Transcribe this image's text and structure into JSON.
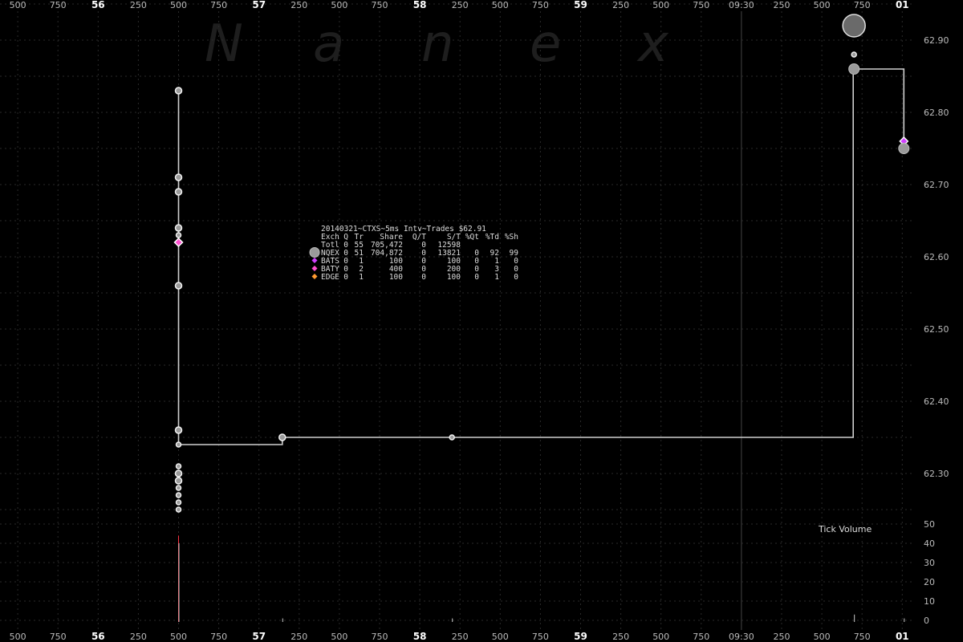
{
  "chart_data": {
    "type": "scatter",
    "title": "20140321~CTXS~5ms Intv~Trades $62.91",
    "watermark": [
      "N",
      "a",
      "n",
      "e",
      "x"
    ],
    "x_units": "ms",
    "x_range": [
      -1000,
      61000
    ],
    "x_ticks": [
      {
        "t": -1000,
        "label": "500",
        "major": false
      },
      {
        "t": -750,
        "label": "750",
        "major": false
      },
      {
        "t": -500,
        "label": "56",
        "major": true
      },
      {
        "t": -250,
        "label": "250",
        "major": false
      },
      {
        "t": 0,
        "label": "500",
        "major": false
      },
      {
        "t": 250,
        "label": "750",
        "major": false
      },
      {
        "t": 500,
        "label": "57",
        "major": true
      },
      {
        "t": 750,
        "label": "250",
        "major": false
      },
      {
        "t": 1000,
        "label": "500",
        "major": false
      },
      {
        "t": 1250,
        "label": "750",
        "major": false
      },
      {
        "t": 1500,
        "label": "58",
        "major": true
      },
      {
        "t": 1750,
        "label": "250",
        "major": false
      },
      {
        "t": 2000,
        "label": "500",
        "major": false
      },
      {
        "t": 2250,
        "label": "750",
        "major": false
      },
      {
        "t": 2500,
        "label": "59",
        "major": true
      },
      {
        "t": 2750,
        "label": "250",
        "major": false
      },
      {
        "t": 3000,
        "label": "500",
        "major": false
      },
      {
        "t": 3250,
        "label": "750",
        "major": false
      },
      {
        "t": 3500,
        "label": "09:30",
        "major": false
      },
      {
        "t": 3750,
        "label": "250",
        "major": false
      },
      {
        "t": 4000,
        "label": "500",
        "major": false
      },
      {
        "t": 4250,
        "label": "750",
        "major": false
      },
      {
        "t": 4500,
        "label": "01",
        "major": true
      }
    ],
    "price_axis": {
      "min": 62.24,
      "max": 62.94,
      "ticks": [
        "62.30",
        "62.40",
        "62.50",
        "62.60",
        "62.70",
        "62.80",
        "62.90"
      ]
    },
    "volume_axis": {
      "label": "Tick Volume",
      "min": 0,
      "max": 53,
      "ticks": [
        "0",
        "10",
        "20",
        "30",
        "40",
        "50"
      ]
    },
    "legend": {
      "header": [
        "Exch",
        "Q",
        "Tr",
        "Share",
        "Q/T",
        "S/T",
        "%Qt",
        "%Td",
        "%Sh"
      ],
      "rows": [
        {
          "exch": "Totl",
          "q": "0",
          "tr": "55",
          "share": "705,472",
          "qt": "0",
          "st": "12598",
          "pqt": "",
          "ptd": "",
          "psh": "",
          "marker": "none",
          "color": ""
        },
        {
          "exch": "NQEX",
          "q": "0",
          "tr": "51",
          "share": "704,872",
          "qt": "0",
          "st": "13821",
          "pqt": "0",
          "ptd": "92",
          "psh": "99",
          "marker": "circle",
          "color": "#9a9a9a"
        },
        {
          "exch": "BATS",
          "q": "0",
          "tr": "1",
          "share": "100",
          "qt": "0",
          "st": "100",
          "pqt": "0",
          "ptd": "1",
          "psh": "0",
          "marker": "diamond",
          "color": "#d040ff"
        },
        {
          "exch": "BATY",
          "q": "0",
          "tr": "2",
          "share": "400",
          "qt": "0",
          "st": "200",
          "pqt": "0",
          "ptd": "3",
          "psh": "0",
          "marker": "diamond",
          "color": "#ff4fd0"
        },
        {
          "exch": "EDGE",
          "q": "0",
          "tr": "1",
          "share": "100",
          "qt": "0",
          "st": "100",
          "pqt": "0",
          "ptd": "1",
          "psh": "0",
          "marker": "diamond",
          "color": "#ff9a30"
        }
      ]
    },
    "step_line": [
      {
        "t": 0,
        "p": 62.83
      },
      {
        "t": 0,
        "p": 62.34
      },
      {
        "t": 645,
        "p": 62.34
      },
      {
        "t": 645,
        "p": 62.35
      },
      {
        "t": 4195,
        "p": 62.35
      },
      {
        "t": 4195,
        "p": 62.86
      },
      {
        "t": 4510,
        "p": 62.86
      },
      {
        "t": 4510,
        "p": 62.75
      }
    ],
    "trades": [
      {
        "t": 0,
        "p": 62.83,
        "exch": "NQEX",
        "size": "s"
      },
      {
        "t": 0,
        "p": 62.71,
        "exch": "NQEX",
        "size": "s"
      },
      {
        "t": 0,
        "p": 62.69,
        "exch": "NQEX",
        "size": "s"
      },
      {
        "t": 0,
        "p": 62.64,
        "exch": "NQEX",
        "size": "s"
      },
      {
        "t": 0,
        "p": 62.63,
        "exch": "NQEX",
        "size": "xs"
      },
      {
        "t": 0,
        "p": 62.62,
        "exch": "BATY",
        "size": "s"
      },
      {
        "t": 0,
        "p": 62.56,
        "exch": "NQEX",
        "size": "s"
      },
      {
        "t": 0,
        "p": 62.36,
        "exch": "NQEX",
        "size": "s"
      },
      {
        "t": 0,
        "p": 62.34,
        "exch": "NQEX",
        "size": "xs"
      },
      {
        "t": 0,
        "p": 62.31,
        "exch": "NQEX",
        "size": "xs"
      },
      {
        "t": 0,
        "p": 62.3,
        "exch": "NQEX",
        "size": "s"
      },
      {
        "t": 0,
        "p": 62.29,
        "exch": "NQEX",
        "size": "s"
      },
      {
        "t": 0,
        "p": 62.28,
        "exch": "NQEX",
        "size": "xs"
      },
      {
        "t": 0,
        "p": 62.27,
        "exch": "NQEX",
        "size": "xs"
      },
      {
        "t": 0,
        "p": 62.26,
        "exch": "NQEX",
        "size": "xs"
      },
      {
        "t": 0,
        "p": 62.25,
        "exch": "NQEX",
        "size": "xs"
      },
      {
        "t": 645,
        "p": 62.35,
        "exch": "NQEX",
        "size": "s"
      },
      {
        "t": 1700,
        "p": 62.35,
        "exch": "NQEX",
        "size": "xs"
      },
      {
        "t": 4200,
        "p": 62.92,
        "exch": "NQEX",
        "size": "xl"
      },
      {
        "t": 4200,
        "p": 62.88,
        "exch": "NQEX",
        "size": "xs"
      },
      {
        "t": 4200,
        "p": 62.86,
        "exch": "NQEX",
        "size": "m"
      },
      {
        "t": 4510,
        "p": 62.76,
        "exch": "BATS",
        "size": "s"
      },
      {
        "t": 4510,
        "p": 62.75,
        "exch": "NQEX",
        "size": "m"
      }
    ],
    "volume_bars": [
      {
        "t": 0,
        "v": 44,
        "color": "#ff3344"
      },
      {
        "t": 0,
        "v": 40,
        "color": "#cccccc"
      },
      {
        "t": 645,
        "v": 1,
        "color": "#cccccc"
      },
      {
        "t": 1700,
        "v": 1,
        "color": "#cccccc"
      },
      {
        "t": 4200,
        "v": 3,
        "color": "#cccccc"
      },
      {
        "t": 4510,
        "v": 1,
        "color": "#cccccc"
      }
    ]
  }
}
